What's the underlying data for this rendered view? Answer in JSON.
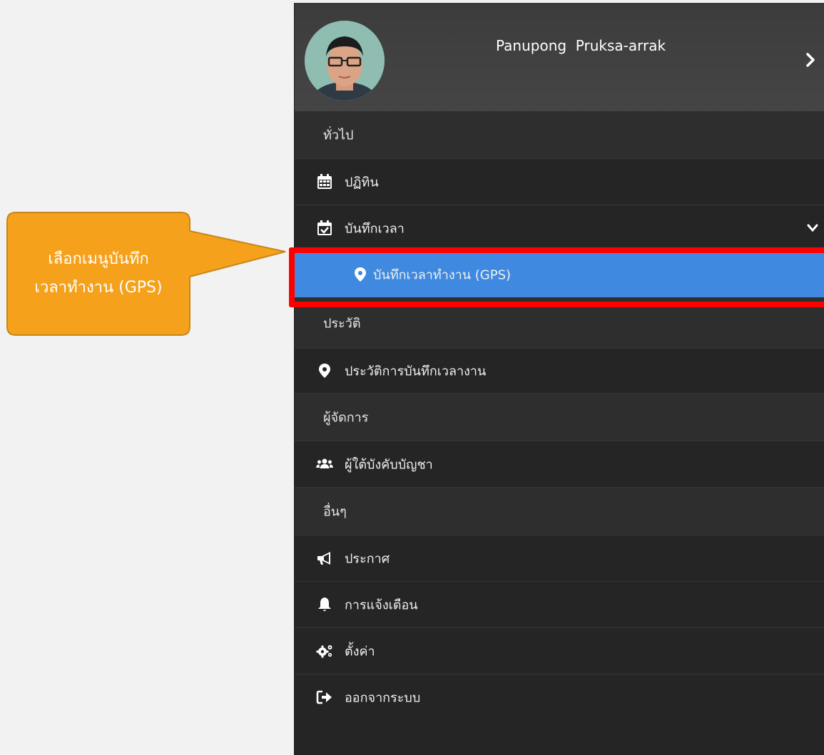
{
  "profile": {
    "name": "Panupong  Pruksa-arrak"
  },
  "menu": {
    "section_general": "ทั่วไป",
    "calendar_label": "ปฏิทิน",
    "timelog_label": "บันทึกเวลา",
    "gps_label": "บันทึกเวลาทำงาน (GPS)",
    "section_history": "ประวัติ",
    "history_label": "ประวัติการบันทึกเวลางาน",
    "section_manager": "ผู้จัดการ",
    "subordinates_label": "ผู้ใต้บังคับบัญชา",
    "section_other": "อื่นๆ",
    "announcement_label": "ประกาศ",
    "notification_label": "การแจ้งเตือน",
    "settings_label": "ตั้งค่า",
    "logout_label": "ออกจากระบบ"
  },
  "callout": {
    "line1": "เลือกเมนูบันทึก",
    "line2": "เวลาทำงาน (GPS)"
  },
  "colors": {
    "drawer_bg": "#252525",
    "section_bg": "#2e2e2e",
    "active_bg": "#3f8ae0",
    "highlight": "#ff0000",
    "callout_bg": "#f5a11c"
  },
  "icons": {
    "calendar": "calendar-icon",
    "timelog": "calendar-check-icon",
    "gps": "map-marker-icon",
    "history": "map-marker-icon",
    "subordinates": "users-icon",
    "announcement": "megaphone-icon",
    "notification": "bell-icon",
    "settings": "gears-icon",
    "logout": "sign-out-icon"
  }
}
